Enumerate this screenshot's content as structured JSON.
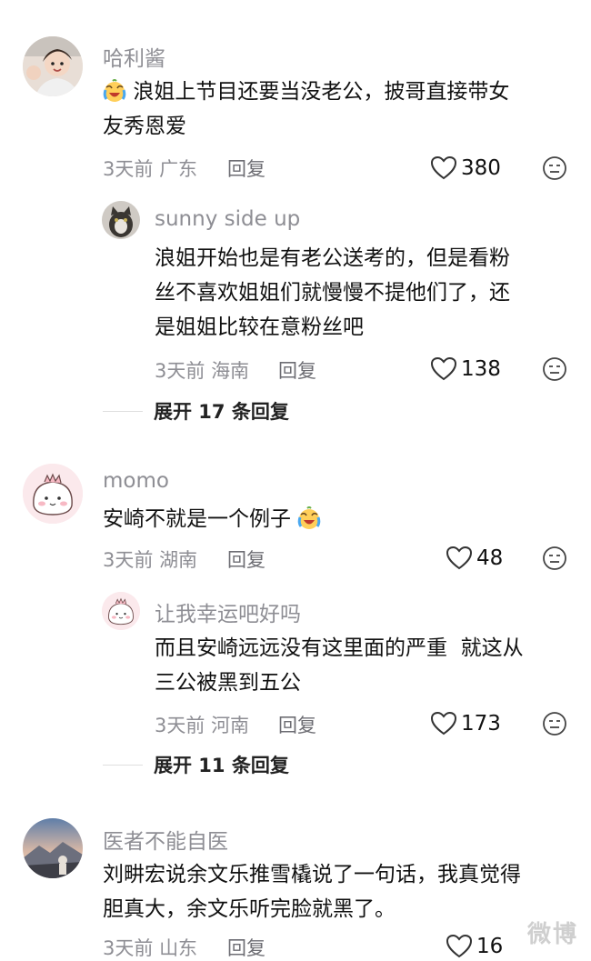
{
  "comments": [
    {
      "username": "哈利酱",
      "lines": [
        "浪姐上节目还要当没老公，披哥直接带女",
        "友秀恩爱"
      ],
      "time": "3天前",
      "location": "广东",
      "reply_label": "回复",
      "likes": "380",
      "emoji": "crying-laughing"
    },
    {
      "username": "sunny side up",
      "lines": [
        "浪姐开始也是有老公送考的，但是看粉",
        "丝不喜欢姐姐们就慢慢不提他们了，还",
        "是姐姐比较在意粉丝吧"
      ],
      "time": "3天前",
      "location": "海南",
      "reply_label": "回复",
      "likes": "138"
    },
    {
      "username": "momo",
      "lines": [
        "安崎不就是一个例子"
      ],
      "time": "3天前",
      "location": "湖南",
      "reply_label": "回复",
      "likes": "48",
      "emoji": "crying-laughing"
    },
    {
      "username": "让我幸运吧好吗",
      "lines": [
        "而且安崎远远没有这里面的严重  就这从",
        "三公被黑到五公"
      ],
      "time": "3天前",
      "location": "河南",
      "reply_label": "回复",
      "likes": "173"
    },
    {
      "username": "医者不能自医",
      "lines": [
        "刘畊宏说余文乐推雪橇说了一句话，我真觉得",
        "胆真大，余文乐听完脸就黑了。"
      ],
      "time": "3天前",
      "location": "山东",
      "reply_label": "回复",
      "likes": "16"
    }
  ],
  "expand": [
    {
      "label": "展开 17 条回复"
    },
    {
      "label": "展开 11 条回复"
    }
  ],
  "watermark": "微博",
  "colors": {
    "meta_gray": "#8e8e94",
    "text": "#111111",
    "background": "#ffffff"
  }
}
